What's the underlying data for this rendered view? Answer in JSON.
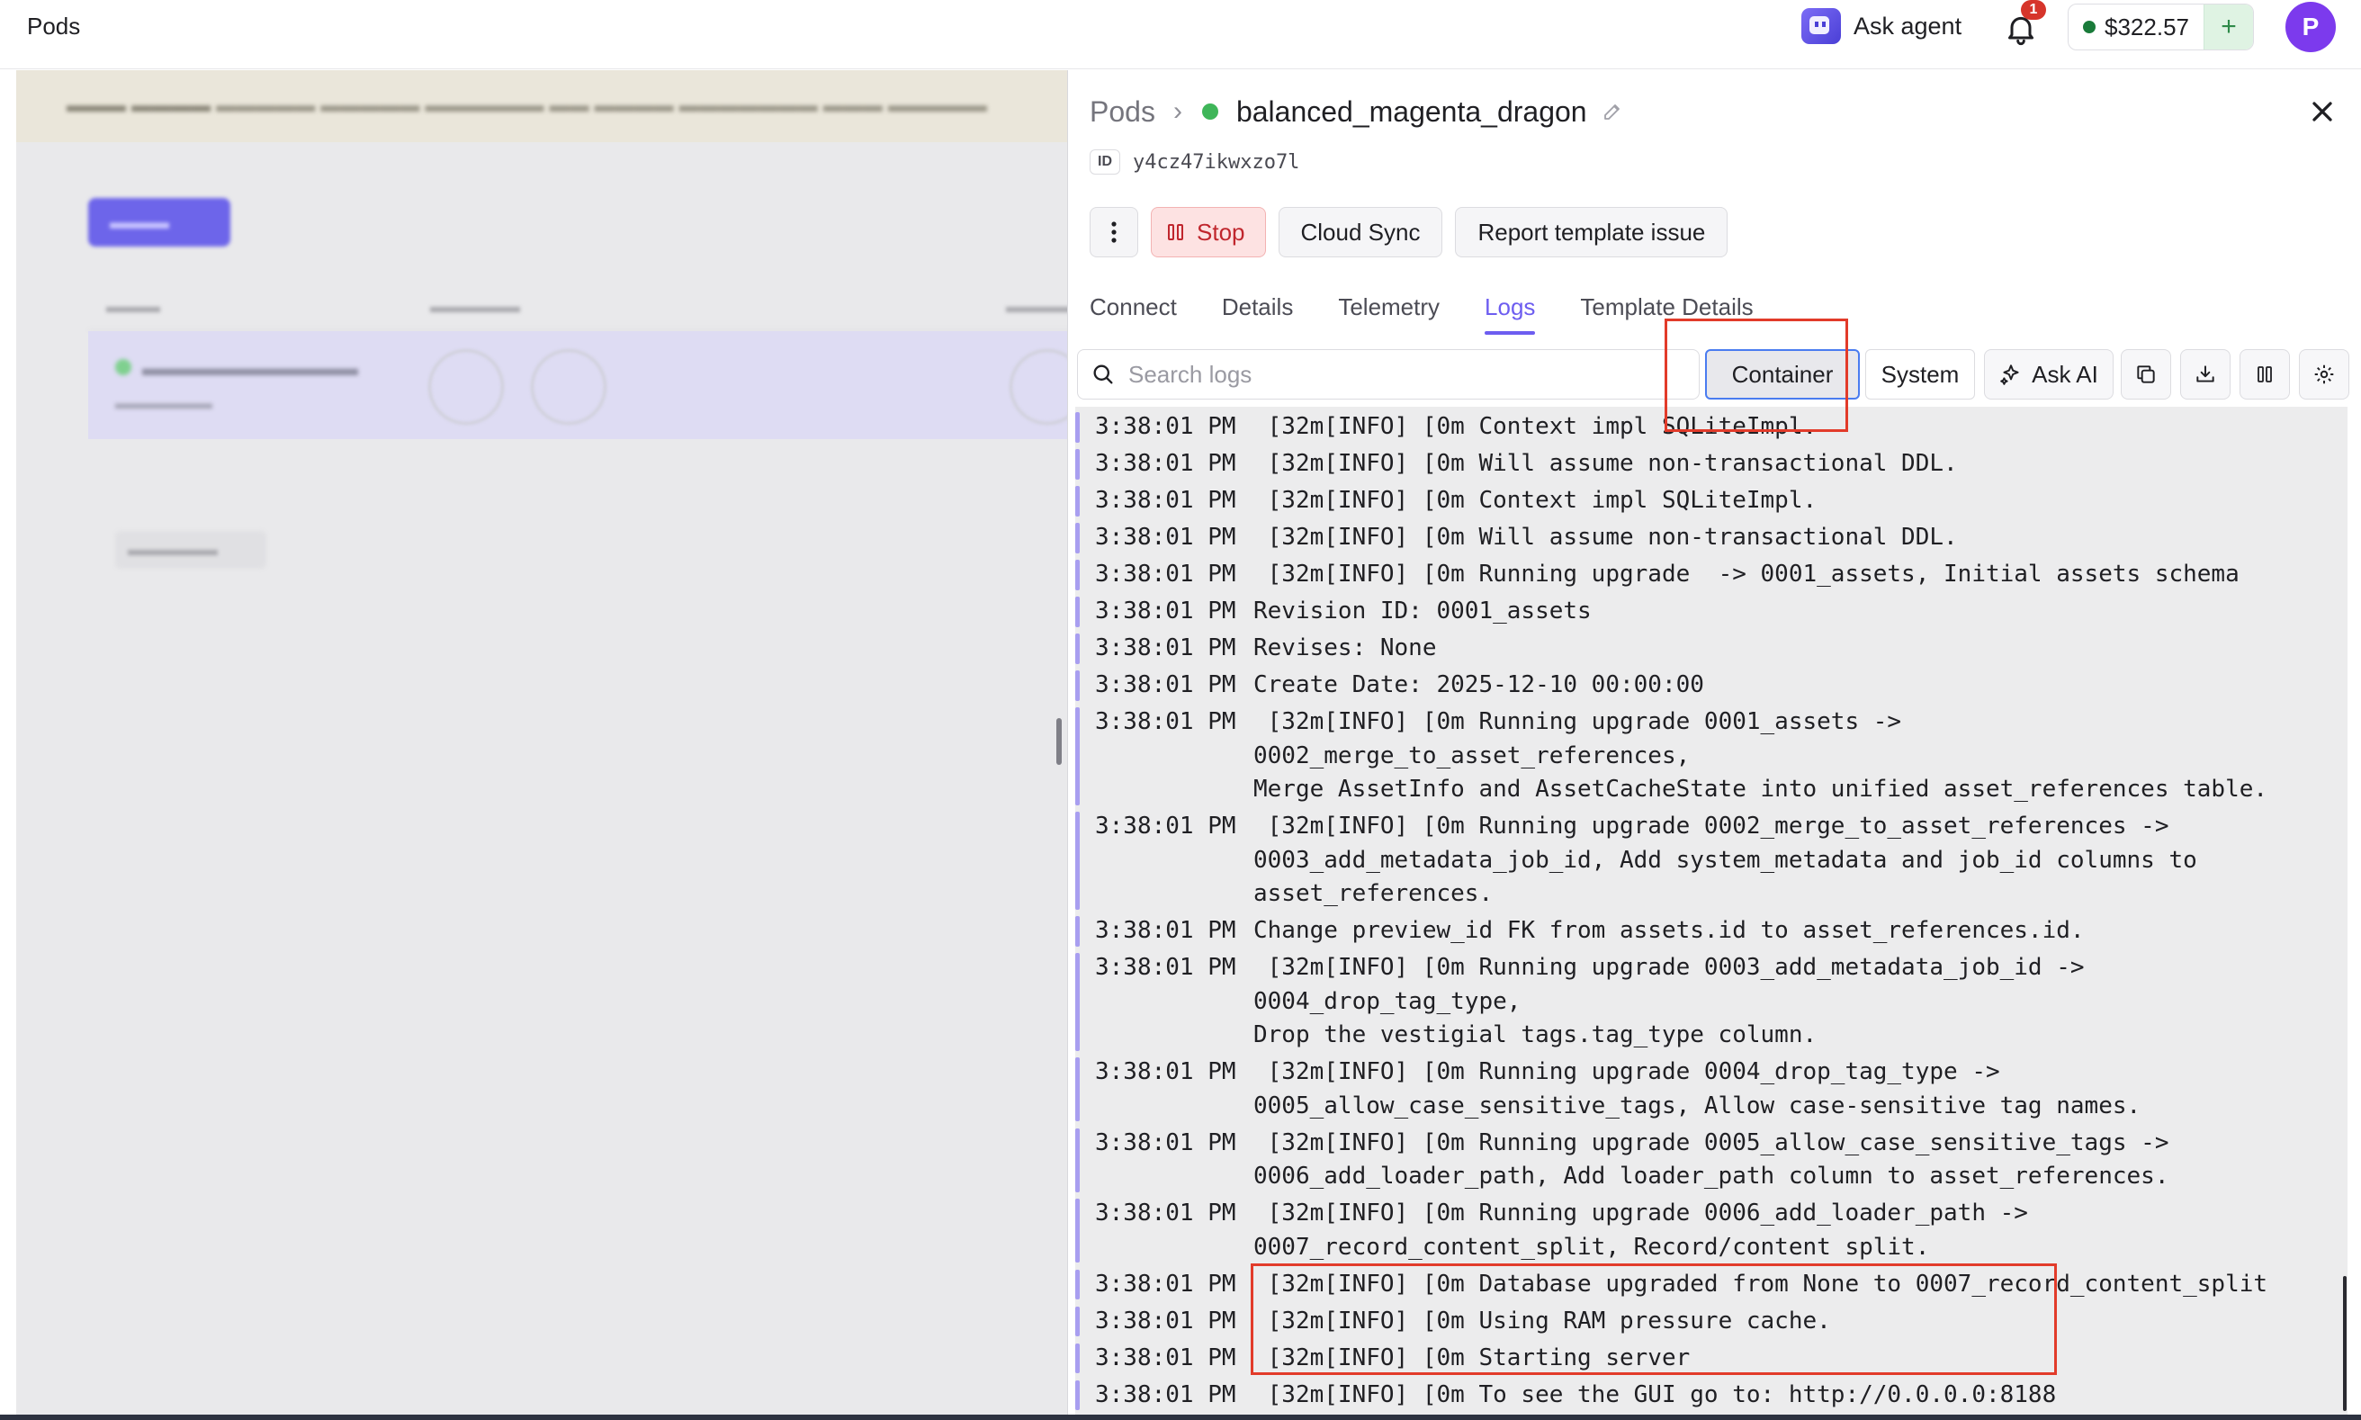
{
  "topbar": {
    "app_title": "Pods",
    "agent_label": "Ask agent",
    "notification_count": "1",
    "balance": "$322.57",
    "add_funds": "+",
    "avatar_letter": "P",
    "icons": [
      "agent-logo-icon",
      "bell-icon",
      "plus-icon"
    ]
  },
  "panel": {
    "breadcrumb_root": "Pods",
    "pod_name": "balanced_magenta_dragon",
    "status_color": "#3fb659",
    "id_label": "ID",
    "id_value": "y4cz47ikwxzo7l",
    "actions": {
      "stop": "Stop",
      "cloud_sync": "Cloud Sync",
      "report": "Report template issue"
    },
    "tabs": [
      {
        "label": "Connect"
      },
      {
        "label": "Details"
      },
      {
        "label": "Telemetry"
      },
      {
        "label": "Logs",
        "active": true
      },
      {
        "label": "Template Details"
      }
    ],
    "logs_toolbar": {
      "search_placeholder": "Search logs",
      "container": "Container",
      "system": "System",
      "ask_ai": "Ask AI",
      "selected_source": "Container"
    },
    "accent_color": "#6d5df0"
  },
  "logs": [
    {
      "time": "3:38:01 PM",
      "text": " [32m[INFO] [0m Context impl SQLiteImpl."
    },
    {
      "time": "3:38:01 PM",
      "text": " [32m[INFO] [0m Will assume non-transactional DDL."
    },
    {
      "time": "3:38:01 PM",
      "text": " [32m[INFO] [0m Context impl SQLiteImpl."
    },
    {
      "time": "3:38:01 PM",
      "text": " [32m[INFO] [0m Will assume non-transactional DDL."
    },
    {
      "time": "3:38:01 PM",
      "text": " [32m[INFO] [0m Running upgrade  -> 0001_assets, Initial assets schema"
    },
    {
      "time": "3:38:01 PM",
      "text": "Revision ID: 0001_assets"
    },
    {
      "time": "3:38:01 PM",
      "text": "Revises: None"
    },
    {
      "time": "3:38:01 PM",
      "text": "Create Date: 2025-12-10 00:00:00"
    },
    {
      "time": "3:38:01 PM",
      "text": " [32m[INFO] [0m Running upgrade 0001_assets -> 0002_merge_to_asset_references,\nMerge AssetInfo and AssetCacheState into unified asset_references table."
    },
    {
      "time": "3:38:01 PM",
      "text": " [32m[INFO] [0m Running upgrade 0002_merge_to_asset_references ->\n0003_add_metadata_job_id, Add system_metadata and job_id columns to\nasset_references."
    },
    {
      "time": "3:38:01 PM",
      "text": "Change preview_id FK from assets.id to asset_references.id."
    },
    {
      "time": "3:38:01 PM",
      "text": " [32m[INFO] [0m Running upgrade 0003_add_metadata_job_id -> 0004_drop_tag_type,\nDrop the vestigial tags.tag_type column."
    },
    {
      "time": "3:38:01 PM",
      "text": " [32m[INFO] [0m Running upgrade 0004_drop_tag_type ->\n0005_allow_case_sensitive_tags, Allow case-sensitive tag names."
    },
    {
      "time": "3:38:01 PM",
      "text": " [32m[INFO] [0m Running upgrade 0005_allow_case_sensitive_tags ->\n0006_add_loader_path, Add loader_path column to asset_references."
    },
    {
      "time": "3:38:01 PM",
      "text": " [32m[INFO] [0m Running upgrade 0006_add_loader_path ->\n0007_record_content_split, Record/content split."
    },
    {
      "time": "3:38:01 PM",
      "text": " [32m[INFO] [0m Database upgraded from None to 0007_record_content_split"
    },
    {
      "time": "3:38:01 PM",
      "text": " [32m[INFO] [0m Using RAM pressure cache."
    },
    {
      "time": "3:38:01 PM",
      "text": " [32m[INFO] [0m Starting server"
    },
    {
      "time": "3:38:01 PM",
      "text": " [32m[INFO] [0m To see the GUI go to: http://0.0.0.0:8188"
    }
  ]
}
